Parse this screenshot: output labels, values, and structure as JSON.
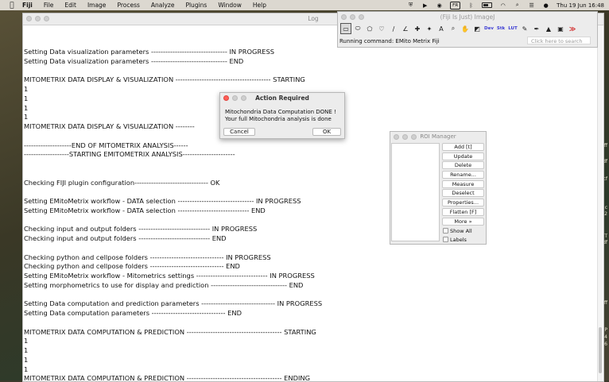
{
  "menubar": {
    "app": "Fiji",
    "items": [
      "File",
      "Edit",
      "Image",
      "Process",
      "Analyze",
      "Plugins",
      "Window",
      "Help"
    ],
    "input_source": "FR",
    "datetime": "Thu 19 Jun  16:48"
  },
  "log": {
    "title": "Log",
    "lines": [
      "Setting Data visualization parameters -------------------------------- IN PROGRESS",
      "Setting Data visualization parameters -------------------------------- END",
      "",
      "MITOMETRIX DATA DISPLAY & VISUALIZATION ---------------------------------------- STARTING",
      "1",
      "1",
      "1",
      "1",
      "MITOMETRIX DATA DISPLAY & VISUALIZATION --------",
      "",
      "--------------------END OF MITOMETRIX ANALYSIS------",
      "-------------------STARTING EMITOMETRIX ANALYSIS----------------------",
      "",
      "",
      "Checking FIJI plugin configuration------------------------------- OK",
      "",
      "Setting EMitoMetrix workflow - DATA selection -------------------------------- IN PROGRESS",
      "Setting EMitoMetrix workflow - DATA selection ------------------------------ END",
      "",
      "Checking input and output folders ------------------------------ IN PROGRESS",
      "Checking input and output folders ------------------------------ END",
      "",
      "Checking python and cellpose folders ------------------------------- IN PROGRESS",
      "Checking python and cellpose folders ------------------------------- END",
      "Setting EMitoMetrix workflow - Mitometrics settings ------------------------------ IN PROGRESS",
      "Setting morphometrics to use for display and prediction -------------------------------- END",
      "",
      "Setting Data computation and prediction parameters ------------------------------- IN PROGRESS",
      "Setting Data computation parameters ------------------------------- END",
      "",
      "MITOMETRIX DATA COMPUTATION & PREDICTION ---------------------------------------- STARTING",
      "1",
      "1",
      "1",
      "1",
      "MITOMETRIX DATA COMPUTATION & PREDICTION ---------------------------------------- ENDING"
    ]
  },
  "imagej": {
    "title": "(Fiji Is Just) ImageJ",
    "status": "Running command: EMito Metrix Fiji",
    "search_placeholder": "Click here to search",
    "tool_text": {
      "dev": "Dev",
      "stk": "Stk",
      "lut": "LUT"
    }
  },
  "roi_manager": {
    "title": "ROI Manager",
    "buttons": [
      "Add [t]",
      "Update",
      "Delete",
      "Rename...",
      "Measure",
      "Deselect",
      "Properties...",
      "Flatten [F]",
      "More »"
    ],
    "checkboxes": [
      "Show All",
      "Labels"
    ]
  },
  "dialog": {
    "title": "Action Required",
    "message_line1": "Mitochondria Data Computation DONE !",
    "message_line2": "Your full Mitochondria analysis is done",
    "cancel_label": "Cancel",
    "ok_label": "OK"
  },
  "desktop": {
    "labels": [
      "ff",
      "df",
      "cf",
      "c",
      "32",
      "T",
      "df",
      "ff",
      "P",
      "24",
      "6"
    ]
  }
}
